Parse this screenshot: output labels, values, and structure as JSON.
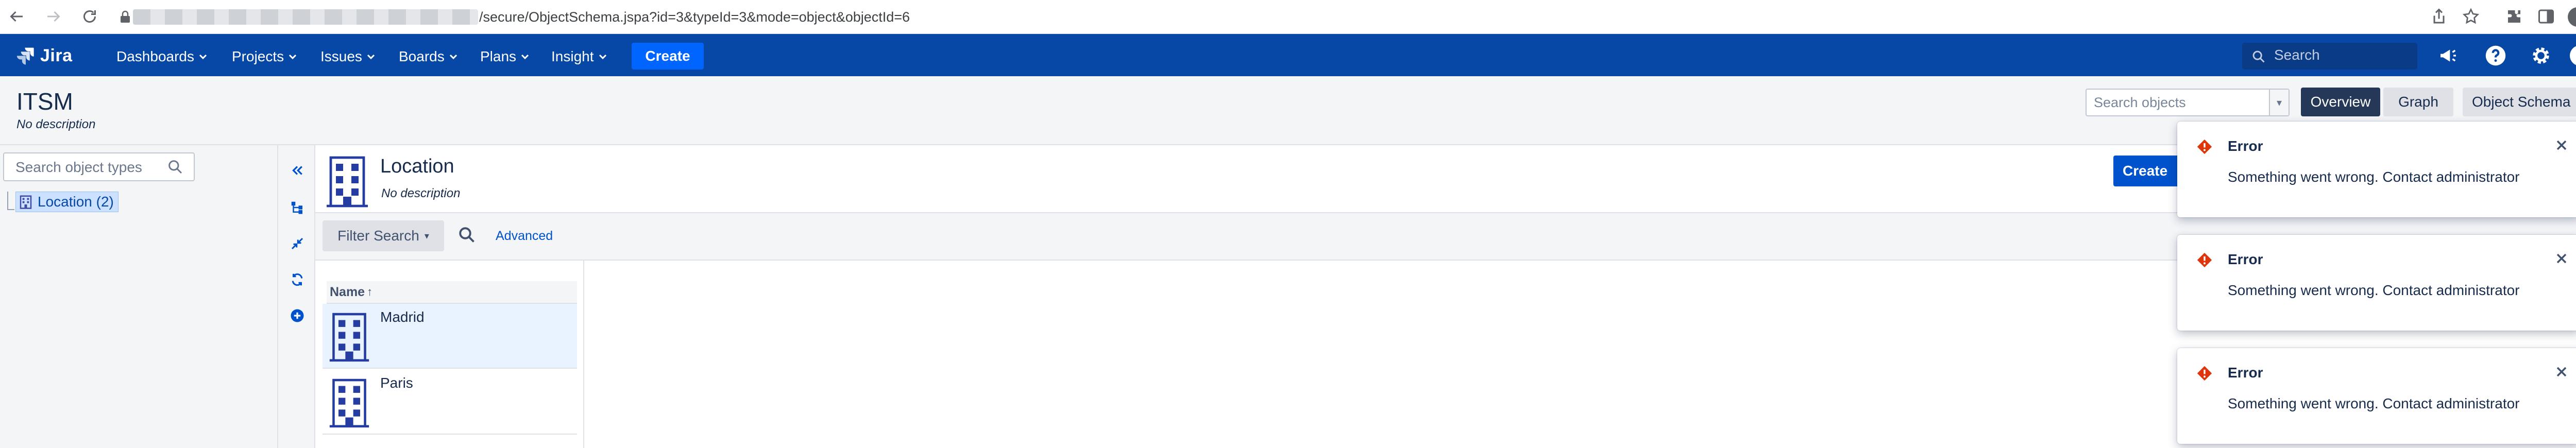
{
  "browser": {
    "url_path": "/secure/ObjectSchema.jspa?id=3&typeId=3&mode=object&objectId=6"
  },
  "header": {
    "logo": "Jira",
    "menu": [
      "Dashboards",
      "Projects",
      "Issues",
      "Boards",
      "Plans",
      "Insight"
    ],
    "create_label": "Create",
    "search_placeholder": "Search"
  },
  "schema": {
    "title": "ITSM",
    "description": "No description",
    "search_objects_placeholder": "Search objects",
    "tabs": [
      "Overview",
      "Graph",
      "Object Schema"
    ]
  },
  "tree": {
    "search_placeholder": "Search object types",
    "item_label": "Location (2)"
  },
  "object_type": {
    "title": "Location",
    "description": "No description",
    "create_label": "Create"
  },
  "filter": {
    "filter_search_label": "Filter Search",
    "advanced_label": "Advanced"
  },
  "list": {
    "column_header": "Name",
    "rows": [
      "Madrid",
      "Paris"
    ]
  },
  "flags": [
    {
      "title": "Error",
      "message": "Something went wrong. Contact administrator"
    },
    {
      "title": "Error",
      "message": "Something went wrong. Contact administrator"
    },
    {
      "title": "Error",
      "message": "Something went wrong. Contact administrator"
    }
  ],
  "colors": {
    "header_bg": "#0747a6",
    "primary": "#0052cc",
    "error": "#de350b"
  }
}
